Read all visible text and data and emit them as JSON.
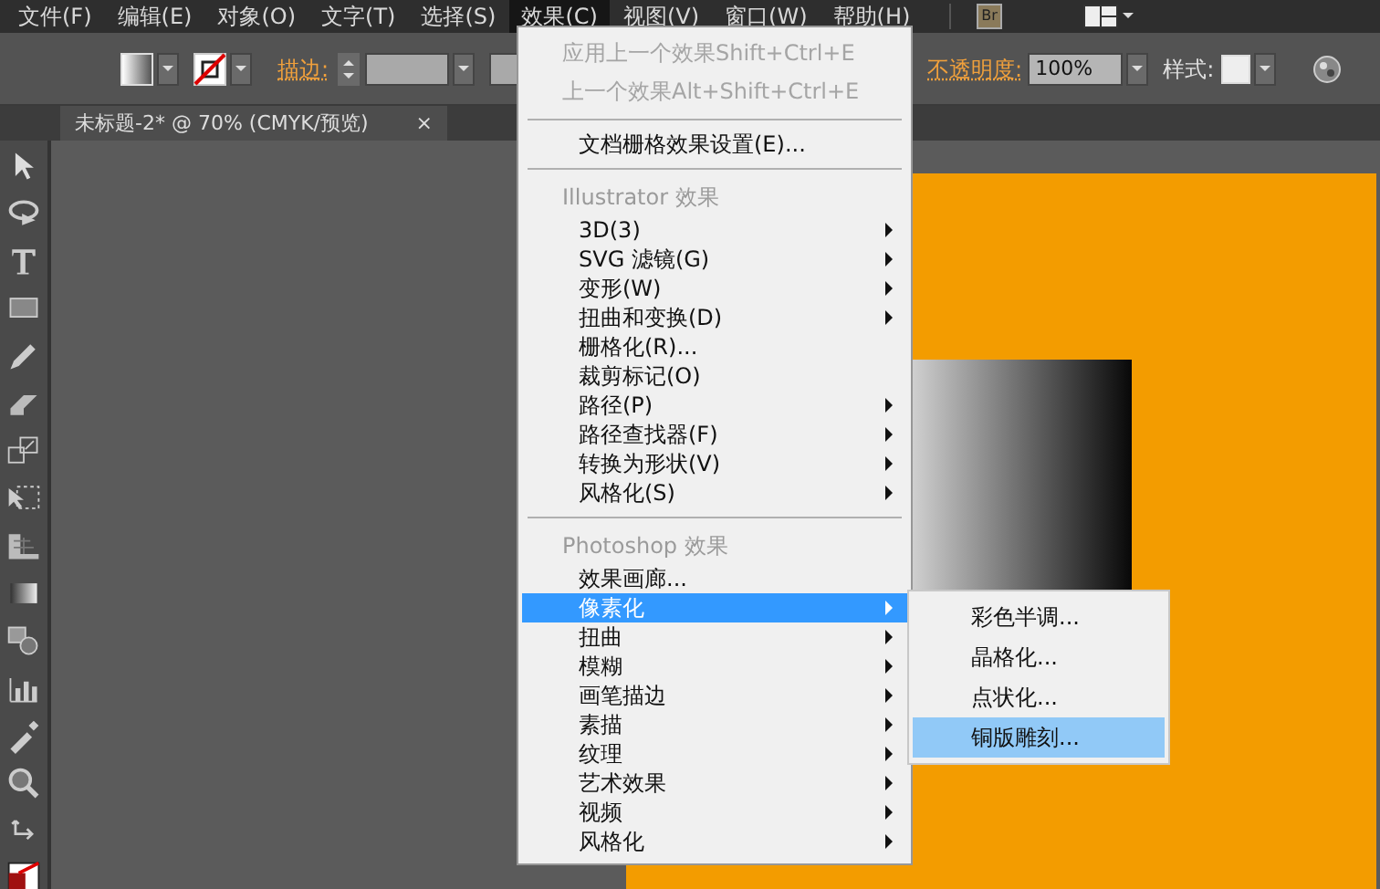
{
  "menu_bar": [
    {
      "label": "文件(F)",
      "selected": false
    },
    {
      "label": "编辑(E)",
      "selected": false
    },
    {
      "label": "对象(O)",
      "selected": false
    },
    {
      "label": "文字(T)",
      "selected": false
    },
    {
      "label": "选择(S)",
      "selected": false
    },
    {
      "label": "效果(C)",
      "selected": true
    },
    {
      "label": "视图(V)",
      "selected": false
    },
    {
      "label": "窗口(W)",
      "selected": false
    },
    {
      "label": "帮助(H)",
      "selected": false
    }
  ],
  "bridge_button": "Br",
  "control_bar": {
    "stroke_label": "描边:",
    "opacity_label": "不透明度:",
    "opacity_value": "100%",
    "style_label": "样式:"
  },
  "document_tab": {
    "title": "未标题-2* @ 70% (CMYK/预览)",
    "close": "×"
  },
  "effects_menu": [
    {
      "kind": "command",
      "label": "应用上一个效果",
      "shortcut": "Shift+Ctrl+E",
      "disabled": true,
      "submenu": false,
      "selected": false
    },
    {
      "kind": "command",
      "label": "上一个效果",
      "shortcut": "Alt+Shift+Ctrl+E",
      "disabled": true,
      "submenu": false,
      "selected": false
    },
    {
      "kind": "separator"
    },
    {
      "kind": "command",
      "label": "文档栅格效果设置(E)...",
      "disabled": false,
      "submenu": false,
      "selected": false
    },
    {
      "kind": "separator"
    },
    {
      "kind": "header",
      "label": "Illustrator 效果"
    },
    {
      "kind": "command",
      "label": "3D(3)",
      "disabled": false,
      "submenu": true,
      "selected": false
    },
    {
      "kind": "command",
      "label": "SVG 滤镜(G)",
      "disabled": false,
      "submenu": true,
      "selected": false
    },
    {
      "kind": "command",
      "label": "变形(W)",
      "disabled": false,
      "submenu": true,
      "selected": false
    },
    {
      "kind": "command",
      "label": "扭曲和变换(D)",
      "disabled": false,
      "submenu": true,
      "selected": false
    },
    {
      "kind": "command",
      "label": "栅格化(R)...",
      "disabled": false,
      "submenu": false,
      "selected": false
    },
    {
      "kind": "command",
      "label": "裁剪标记(O)",
      "disabled": false,
      "submenu": false,
      "selected": false
    },
    {
      "kind": "command",
      "label": "路径(P)",
      "disabled": false,
      "submenu": true,
      "selected": false
    },
    {
      "kind": "command",
      "label": "路径查找器(F)",
      "disabled": false,
      "submenu": true,
      "selected": false
    },
    {
      "kind": "command",
      "label": "转换为形状(V)",
      "disabled": false,
      "submenu": true,
      "selected": false
    },
    {
      "kind": "command",
      "label": "风格化(S)",
      "disabled": false,
      "submenu": true,
      "selected": false
    },
    {
      "kind": "separator"
    },
    {
      "kind": "header",
      "label": "Photoshop 效果"
    },
    {
      "kind": "command",
      "label": "效果画廊...",
      "disabled": false,
      "submenu": false,
      "selected": false
    },
    {
      "kind": "command",
      "label": "像素化",
      "disabled": false,
      "submenu": true,
      "selected": true
    },
    {
      "kind": "command",
      "label": "扭曲",
      "disabled": false,
      "submenu": true,
      "selected": false
    },
    {
      "kind": "command",
      "label": "模糊",
      "disabled": false,
      "submenu": true,
      "selected": false
    },
    {
      "kind": "command",
      "label": "画笔描边",
      "disabled": false,
      "submenu": true,
      "selected": false
    },
    {
      "kind": "command",
      "label": "素描",
      "disabled": false,
      "submenu": true,
      "selected": false
    },
    {
      "kind": "command",
      "label": "纹理",
      "disabled": false,
      "submenu": true,
      "selected": false
    },
    {
      "kind": "command",
      "label": "艺术效果",
      "disabled": false,
      "submenu": true,
      "selected": false
    },
    {
      "kind": "command",
      "label": "视频",
      "disabled": false,
      "submenu": true,
      "selected": false
    },
    {
      "kind": "command",
      "label": "风格化",
      "disabled": false,
      "submenu": true,
      "selected": false
    }
  ],
  "pixelate_submenu": [
    {
      "label": "彩色半调...",
      "selected": false
    },
    {
      "label": "晶格化...",
      "selected": false
    },
    {
      "label": "点状化...",
      "selected": false
    },
    {
      "label": "铜版雕刻...",
      "selected": true
    }
  ]
}
